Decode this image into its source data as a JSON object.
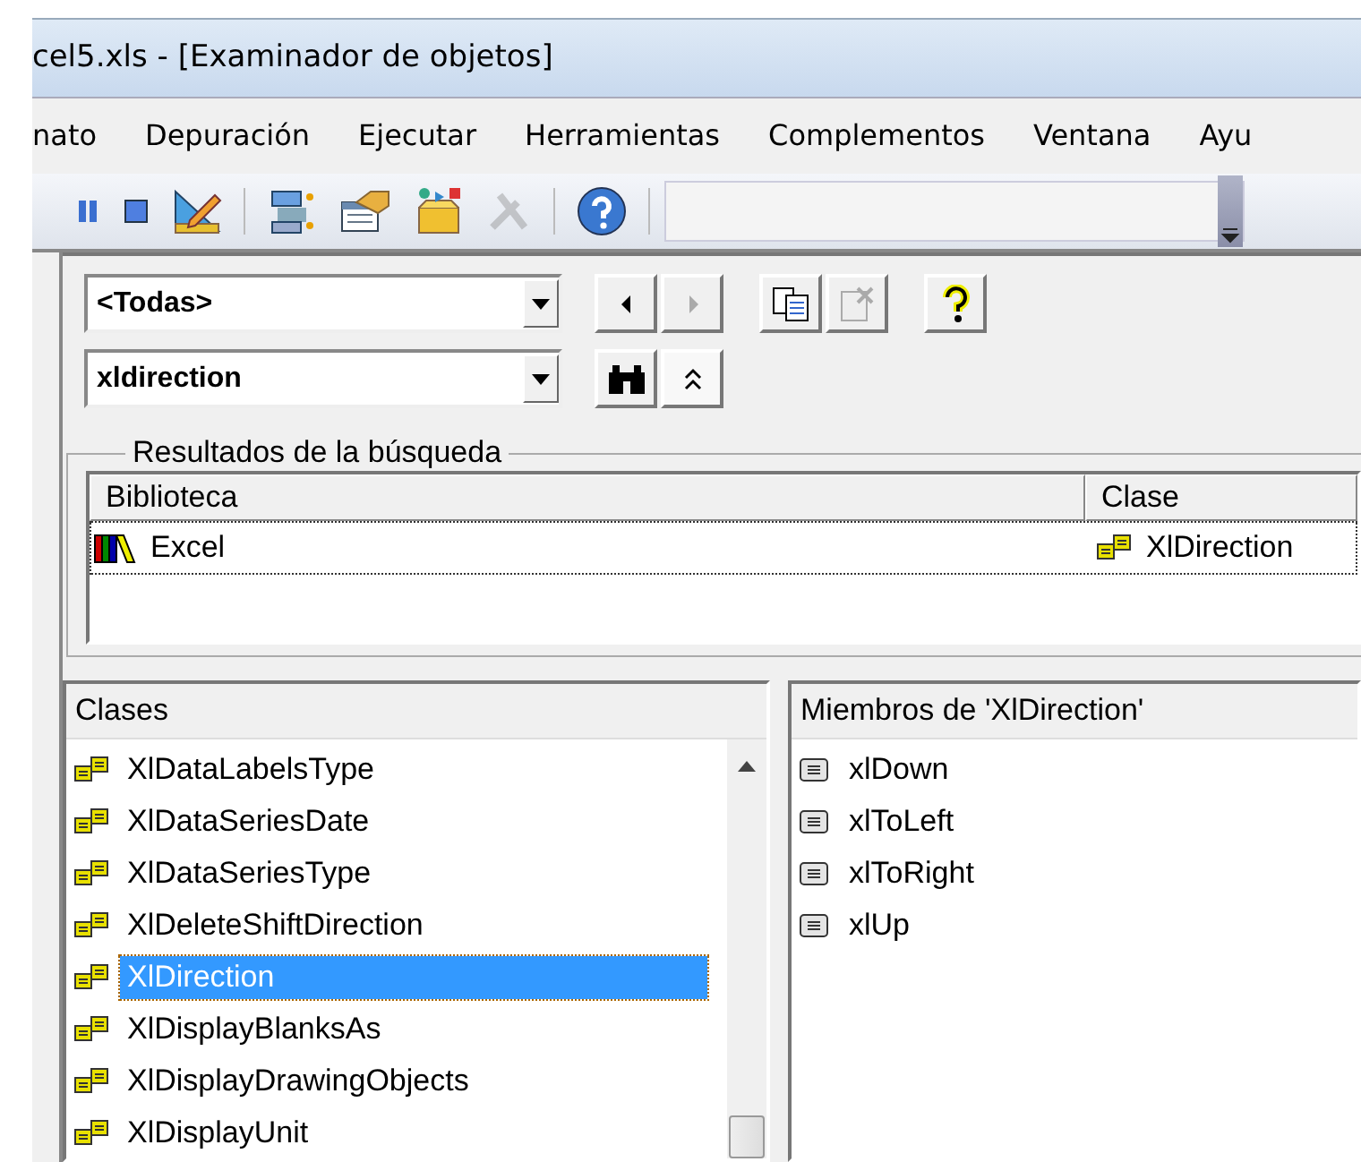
{
  "window": {
    "title": "cel5.xls - [Examinador de objetos]"
  },
  "menu": [
    {
      "label": "nato"
    },
    {
      "label": "Depuración"
    },
    {
      "label": "Ejecutar"
    },
    {
      "label": "Herramientas"
    },
    {
      "label": "Complementos"
    },
    {
      "label": "Ventana"
    },
    {
      "label": "Ayu"
    }
  ],
  "toolbar": [
    {
      "kind": "pause",
      "disabled": false
    },
    {
      "kind": "stop",
      "disabled": false
    },
    {
      "kind": "design",
      "disabled": false
    },
    {
      "kind": "separator",
      "disabled": false
    },
    {
      "kind": "project",
      "disabled": false
    },
    {
      "kind": "properties",
      "disabled": false
    },
    {
      "kind": "toolbox",
      "disabled": false
    },
    {
      "kind": "tools",
      "disabled": true
    },
    {
      "kind": "separator",
      "disabled": false
    },
    {
      "kind": "help",
      "disabled": false
    },
    {
      "kind": "separator",
      "disabled": false
    },
    {
      "kind": "combo",
      "disabled": false
    }
  ],
  "browser": {
    "library_combo": {
      "value": "<Todas>"
    },
    "search_combo": {
      "value": "xldirection"
    },
    "nav_buttons": [
      {
        "kind": "back",
        "disabled": false
      },
      {
        "kind": "forward",
        "disabled": true
      },
      {
        "kind": "gap"
      },
      {
        "kind": "copy",
        "disabled": false
      },
      {
        "kind": "definition",
        "disabled": true
      },
      {
        "kind": "gap"
      },
      {
        "kind": "help",
        "disabled": false
      }
    ],
    "search_buttons": [
      {
        "kind": "search",
        "disabled": false
      },
      {
        "kind": "collapse",
        "disabled": false
      }
    ],
    "results": {
      "title": "Resultados de la búsqueda",
      "columns": [
        "Biblioteca",
        "Clase"
      ],
      "rows": [
        {
          "library": "Excel",
          "class": "XlDirection",
          "selected": true
        }
      ]
    },
    "classes": {
      "header": "Clases",
      "items": [
        {
          "name": "XlDataLabelsType",
          "selected": false
        },
        {
          "name": "XlDataSeriesDate",
          "selected": false
        },
        {
          "name": "XlDataSeriesType",
          "selected": false
        },
        {
          "name": "XlDeleteShiftDirection",
          "selected": false
        },
        {
          "name": "XlDirection",
          "selected": true
        },
        {
          "name": "XlDisplayBlanksAs",
          "selected": false
        },
        {
          "name": "XlDisplayDrawingObjects",
          "selected": false
        },
        {
          "name": "XlDisplayUnit",
          "selected": false
        }
      ]
    },
    "members": {
      "header": "Miembros de 'XlDirection'",
      "items": [
        {
          "name": "xlDown",
          "selected": false
        },
        {
          "name": "xlToLeft",
          "selected": false
        },
        {
          "name": "xlToRight",
          "selected": false
        },
        {
          "name": "xlUp",
          "selected": false
        }
      ]
    }
  }
}
